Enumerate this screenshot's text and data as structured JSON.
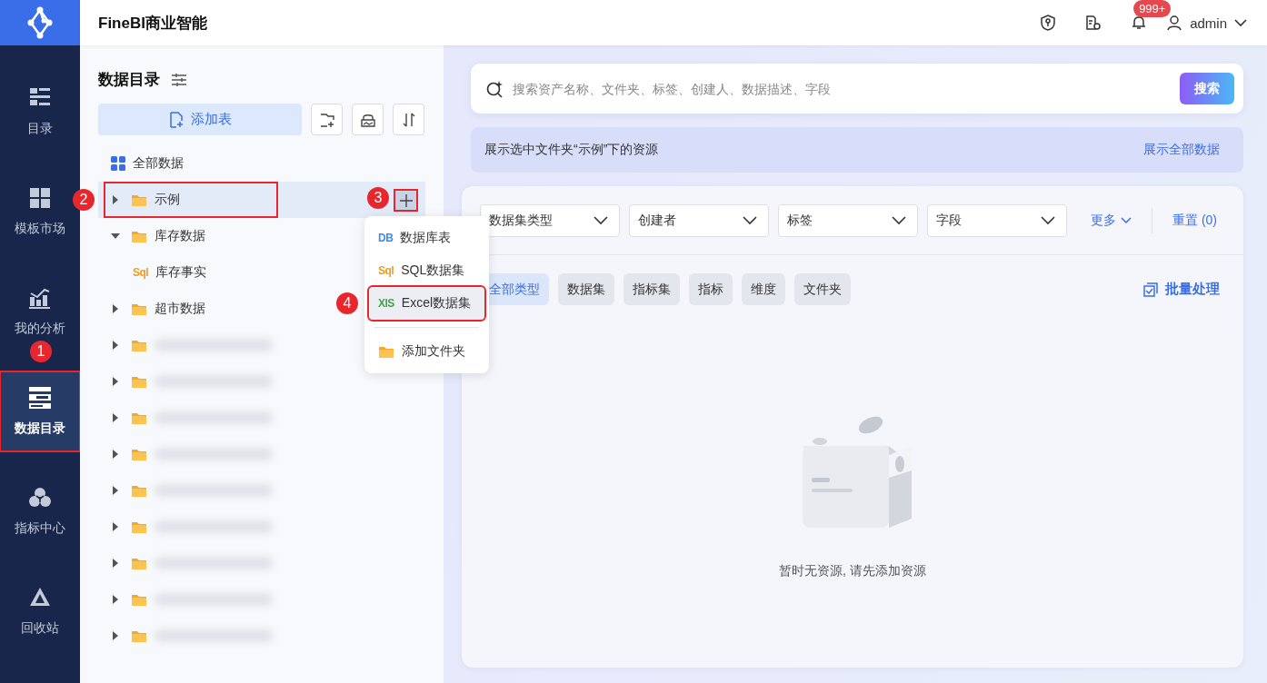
{
  "app": {
    "title": "FineBI商业智能"
  },
  "header": {
    "notification_count": "999+",
    "user": "admin"
  },
  "sidebar": {
    "items": [
      {
        "kind": "catalog",
        "label": "目录",
        "selected": false,
        "highlighted": false
      },
      {
        "kind": "template",
        "label": "模板市场",
        "selected": false,
        "highlighted": false
      },
      {
        "kind": "analysis",
        "label": "我的分析",
        "selected": false,
        "highlighted": false
      },
      {
        "kind": "data",
        "label": "数据目录",
        "selected": true,
        "highlighted": true,
        "step": "1"
      },
      {
        "kind": "metric",
        "label": "指标中心",
        "selected": false,
        "highlighted": false
      },
      {
        "kind": "recycle",
        "label": "回收站",
        "selected": false,
        "highlighted": false
      }
    ]
  },
  "catalog": {
    "title": "数据目录",
    "add_button": "添加表",
    "tree": [
      {
        "kind": "all",
        "label": "全部数据",
        "selected": false,
        "highlighted": false
      },
      {
        "kind": "folder",
        "label": "示例",
        "expanded": false,
        "selected": true,
        "highlighted": true,
        "step": "2",
        "add_step": "3"
      },
      {
        "kind": "folder",
        "label": "库存数据",
        "expanded": true,
        "selected": false,
        "highlighted": false,
        "children": [
          {
            "kind": "sql",
            "icon_text": "Sql",
            "label": "库存事实",
            "selected": false,
            "highlighted": false
          }
        ]
      },
      {
        "kind": "folder",
        "label": "超市数据",
        "expanded": false,
        "selected": false,
        "highlighted": false
      },
      {
        "kind": "blurred",
        "expanded": false,
        "selected": false,
        "highlighted": false
      },
      {
        "kind": "blurred",
        "expanded": false,
        "selected": false,
        "highlighted": false
      },
      {
        "kind": "blurred",
        "expanded": false,
        "selected": false,
        "highlighted": false
      },
      {
        "kind": "blurred",
        "expanded": false,
        "selected": false,
        "highlighted": false
      },
      {
        "kind": "blurred",
        "expanded": false,
        "selected": false,
        "highlighted": false
      },
      {
        "kind": "blurred",
        "expanded": false,
        "selected": false,
        "highlighted": false
      },
      {
        "kind": "blurred",
        "expanded": false,
        "selected": false,
        "highlighted": false
      },
      {
        "kind": "blurred",
        "expanded": false,
        "selected": false,
        "highlighted": false
      },
      {
        "kind": "blurred",
        "expanded": false,
        "selected": false,
        "highlighted": false
      }
    ],
    "add_menu": [
      {
        "kind": "db",
        "icon_text": "DB",
        "label": "数据库表",
        "highlighted": false
      },
      {
        "kind": "sql",
        "icon_text": "Sql",
        "label": "SQL数据集",
        "highlighted": false
      },
      {
        "kind": "xls",
        "icon_text": "XlS",
        "label": "Excel数据集",
        "highlighted": true,
        "step": "4"
      },
      {
        "kind": "folder",
        "label": "添加文件夹",
        "highlighted": false
      }
    ]
  },
  "search": {
    "placeholder": "搜索资产名称、文件夹、标签、创建人、数据描述、字段",
    "button": "搜索"
  },
  "info_bar": {
    "text": "展示选中文件夹“示例”下的资源",
    "link": "展示全部数据"
  },
  "filters": {
    "dropdowns": [
      "数据集类型",
      "创建者",
      "标签",
      "字段"
    ],
    "more": "更多",
    "reset": "重置 (0)"
  },
  "type_chips": [
    {
      "label": "全部类型",
      "selected": true
    },
    {
      "label": "数据集",
      "selected": false
    },
    {
      "label": "指标集",
      "selected": false
    },
    {
      "label": "指标",
      "selected": false
    },
    {
      "label": "维度",
      "selected": false
    },
    {
      "label": "文件夹",
      "selected": false
    }
  ],
  "batch_button": "批量处理",
  "empty_message": "暂时无资源, 请先添加资源"
}
